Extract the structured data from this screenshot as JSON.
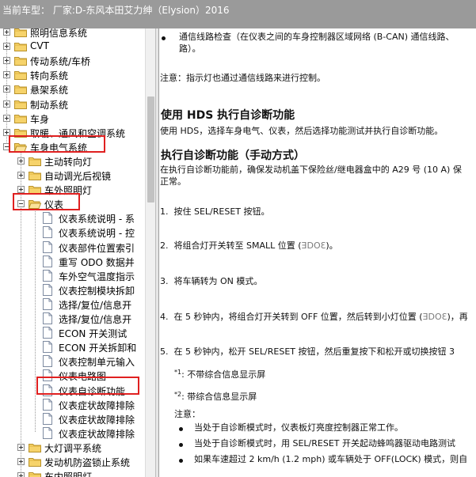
{
  "window": {
    "title": "当前车型：  厂家:D-东风本田艾力绅（Elysion）2016"
  },
  "tree": {
    "items": [
      {
        "label": "照明信息系统",
        "level": 0,
        "kind": "folder",
        "state": "collapsed"
      },
      {
        "label": "CVT",
        "level": 0,
        "kind": "folder",
        "state": "collapsed"
      },
      {
        "label": "传动系统/车桥",
        "level": 0,
        "kind": "folder",
        "state": "collapsed"
      },
      {
        "label": "转向系统",
        "level": 0,
        "kind": "folder",
        "state": "collapsed"
      },
      {
        "label": "悬架系统",
        "level": 0,
        "kind": "folder",
        "state": "collapsed"
      },
      {
        "label": "制动系统",
        "level": 0,
        "kind": "folder",
        "state": "collapsed"
      },
      {
        "label": "车身",
        "level": 0,
        "kind": "folder",
        "state": "collapsed"
      },
      {
        "label": "取暖、通风和空调系统",
        "level": 0,
        "kind": "folder",
        "state": "collapsed"
      },
      {
        "label": "车身电气系统",
        "level": 0,
        "kind": "folder",
        "state": "expanded"
      },
      {
        "label": "主动转向灯",
        "level": 1,
        "kind": "folder",
        "state": "collapsed"
      },
      {
        "label": "自动调光后视镜",
        "level": 1,
        "kind": "folder",
        "state": "collapsed"
      },
      {
        "label": "车外照明灯",
        "level": 1,
        "kind": "folder",
        "state": "collapsed"
      },
      {
        "label": "仪表",
        "level": 1,
        "kind": "folder",
        "state": "expanded"
      },
      {
        "label": "仪表系统说明 - 系",
        "level": 2,
        "kind": "page"
      },
      {
        "label": "仪表系统说明 - 控",
        "level": 2,
        "kind": "page"
      },
      {
        "label": "仪表部件位置索引",
        "level": 2,
        "kind": "page"
      },
      {
        "label": "重写 ODO 数据并",
        "level": 2,
        "kind": "page"
      },
      {
        "label": "车外空气温度指示",
        "level": 2,
        "kind": "page"
      },
      {
        "label": "仪表控制模块拆卸",
        "level": 2,
        "kind": "page"
      },
      {
        "label": "选择/复位/信息开",
        "level": 2,
        "kind": "page"
      },
      {
        "label": "选择/复位/信息开",
        "level": 2,
        "kind": "page"
      },
      {
        "label": "ECON 开关测试",
        "level": 2,
        "kind": "page"
      },
      {
        "label": "ECON 开关拆卸和",
        "level": 2,
        "kind": "page"
      },
      {
        "label": "仪表控制单元输入",
        "level": 2,
        "kind": "page"
      },
      {
        "label": "仪表电路图",
        "level": 2,
        "kind": "page"
      },
      {
        "label": "仪表自诊断功能",
        "level": 2,
        "kind": "page"
      },
      {
        "label": "仪表症状故障排除",
        "level": 2,
        "kind": "page"
      },
      {
        "label": "仪表症状故障排除",
        "level": 2,
        "kind": "page"
      },
      {
        "label": "仪表症状故障排除",
        "level": 2,
        "kind": "page"
      },
      {
        "label": "大灯调平系统",
        "level": 1,
        "kind": "folder",
        "state": "collapsed"
      },
      {
        "label": "发动机防盗锁止系统",
        "level": 1,
        "kind": "folder",
        "state": "collapsed"
      },
      {
        "label": "车内照明灯",
        "level": 1,
        "kind": "folder",
        "state": "collapsed"
      }
    ]
  },
  "content": {
    "top_bullet": "通信线路检查（在仪表之间的车身控制器区域网络 (B-CAN) 通信线路、",
    "top_bullet_cont": "路）。",
    "note": "注意：指示灯也通过通信线路来进行控制。",
    "heading1": "使用 HDS 执行自诊断功能",
    "para1": "使用 HDS，选择车身电气、仪表，然后选择功能测试并执行自诊断功能。",
    "heading2": "执行自诊断功能（手动方式）",
    "para2": "在执行自诊断功能前，确保发动机盖下保险丝/继电器盒中的 A29 号 (10 A) 保",
    "para2_cont": "正常。",
    "steps": [
      {
        "n": "1.",
        "text": "按住 SEL/RESET 按钮。"
      },
      {
        "n": "2.",
        "text": "将组合灯开关转至 SMALL 位置 (",
        "sym": "ƎDOƐ",
        "tail": ")。"
      },
      {
        "n": "3.",
        "text": "将车辆转为 ON 模式。"
      },
      {
        "n": "4.",
        "text": "在 5 秒钟内，将组合灯开关转到 OFF 位置，然后转到小灯位置 (",
        "sym": "ƎDOƐ",
        "tail": ")，再"
      },
      {
        "n": "5.",
        "text": "在 5 秒钟内，松开 SEL/RESET 按钮，然后重复按下和松开或切换按钮 3"
      }
    ],
    "footnotes": [
      {
        "mark": "*1",
        "text": ": 不带综合信息显示屏"
      },
      {
        "mark": "*2",
        "text": ": 带综合信息显示屏"
      }
    ],
    "note2_label": "注意：",
    "note2_items": [
      "当处于自诊断模式时，仪表板灯亮度控制器正常工作。",
      "当处于自诊断模式时，用 SEL/RESET 开关起动蜂鸣器驱动电路测试",
      "如果车速超过 2 km/h (1.2 mph) 或车辆处于 OFF(LOCK) 模式，则自"
    ]
  }
}
